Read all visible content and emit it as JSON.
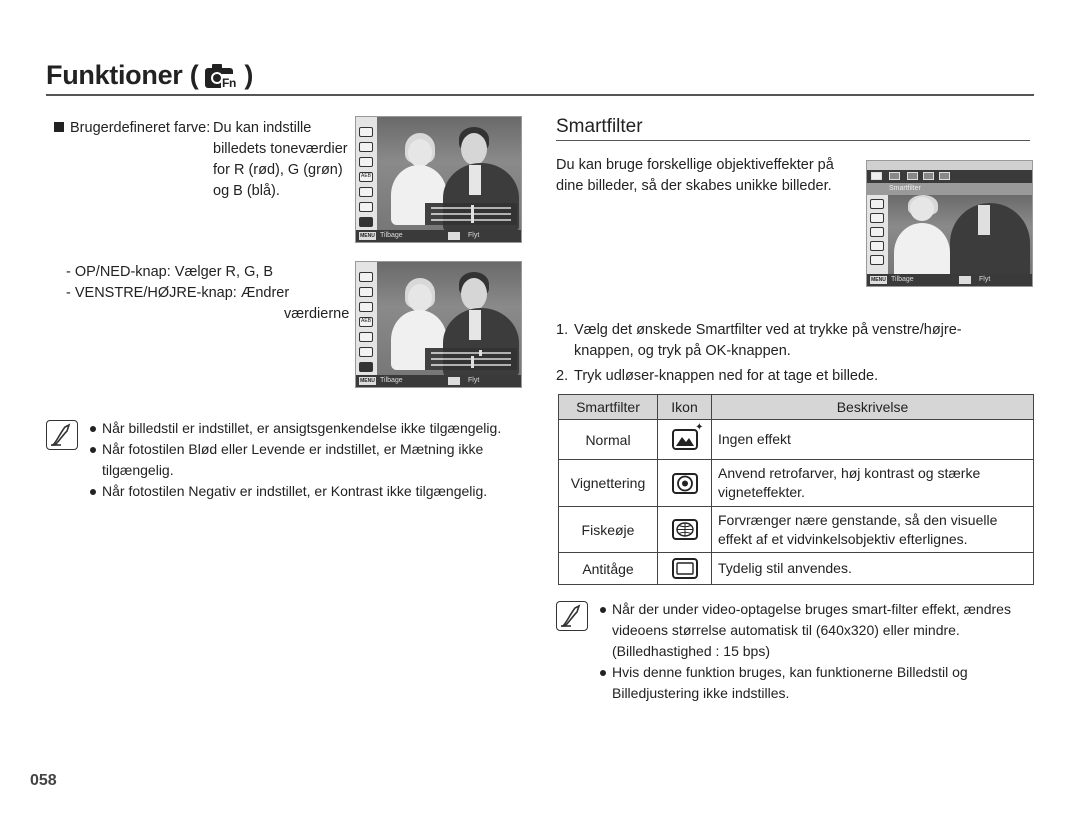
{
  "header": {
    "title": "Funktioner (",
    "title_close": ")",
    "title_icon": "camera-fn-icon"
  },
  "left": {
    "custom_color": {
      "label": "Brugerdefineret farve:",
      "lines": [
        "Du kan indstille",
        "billedets toneværdier",
        "for R (rød), G (grøn)",
        "og B (blå)."
      ]
    },
    "instructions": [
      "- OP/NED-knap: Vælger R, G, B",
      "- VENSTRE/HØJRE-knap: Ændrer",
      "værdierne"
    ],
    "lcd_screens": [
      {
        "back_label": "Tilbage",
        "move_label": "Flyt",
        "menu_badge": "MENU",
        "rgb": {
          "R": 0.5,
          "G": 0.5,
          "B": 0.5
        },
        "sidebar_icons": [
          "up-arrow-icon",
          "photo-style-icon",
          "face-detect-icon",
          "frame-icon",
          "aeb-icon",
          "metering-icon",
          "flash-exposure-icon",
          "custom-color-icon",
          "down-arrow-icon"
        ],
        "aeb_label": "AEB"
      },
      {
        "back_label": "Tilbage",
        "move_label": "Flyt",
        "menu_badge": "MENU",
        "rgb": {
          "R": 0.6,
          "G": 0.5,
          "B": 0.5
        },
        "sidebar_icons": [
          "up-arrow-icon",
          "photo-style-icon",
          "face-detect-icon",
          "frame-icon",
          "aeb-icon",
          "metering-icon",
          "flash-exposure-icon",
          "custom-color-icon",
          "down-arrow-icon"
        ],
        "aeb_label": "AEB"
      }
    ],
    "notes": [
      "Når billedstil er indstillet, er ansigtsgenkendelse ikke tilgængelig.",
      "Når fotostilen Blød eller Levende er indstillet, er Mætning ikke tilgængelig.",
      "Når fotostilen Negativ er indstillet, er Kontrast ikke tilgængelig."
    ]
  },
  "right": {
    "heading": "Smartfilter",
    "intro": [
      "Du kan bruge forskellige objektiveffekter på",
      "dine billeder, så der skabes unikke billeder."
    ],
    "lcd": {
      "menu_label": "Smartfilter",
      "back_label": "Tilbage",
      "move_label": "Flyt",
      "menu_badge": "MENU"
    },
    "steps": [
      {
        "num": "1.",
        "text": [
          "Vælg det ønskede Smartfilter ved at trykke på venstre/højre-",
          "knappen, og tryk på OK-knappen."
        ]
      },
      {
        "num": "2.",
        "text": [
          "Tryk udløser-knappen ned for at tage et billede."
        ]
      }
    ],
    "table": {
      "headers": [
        "Smartfilter",
        "Ikon",
        "Beskrivelse"
      ],
      "rows": [
        {
          "name": "Normal",
          "icon": "normal-filter-icon",
          "desc": [
            "Ingen effekt"
          ]
        },
        {
          "name": "Vignettering",
          "icon": "vignetting-icon",
          "desc": [
            "Anvend retrofarver, høj kontrast og stærke",
            "vigneteffekter."
          ]
        },
        {
          "name": "Fiskeøje",
          "icon": "fisheye-icon",
          "desc": [
            "Forvrænger nære genstande, så den visuelle",
            "effekt af et vidvinkelsobjektiv efterlignes."
          ]
        },
        {
          "name": "Antitåge",
          "icon": "defog-icon",
          "desc": [
            "Tydelig stil anvendes."
          ]
        }
      ]
    },
    "notes": [
      [
        "Når der under video-optagelse bruges smart-filter effekt, ændres",
        "videoens størrelse automatisk til (640x320) eller mindre.",
        "(Billedhastighed : 15 bps)"
      ],
      [
        "Hvis denne funktion bruges, kan funktionerne Billedstil og",
        "Billedjustering ikke indstilles."
      ]
    ]
  },
  "footer": {
    "page_number": "058"
  }
}
